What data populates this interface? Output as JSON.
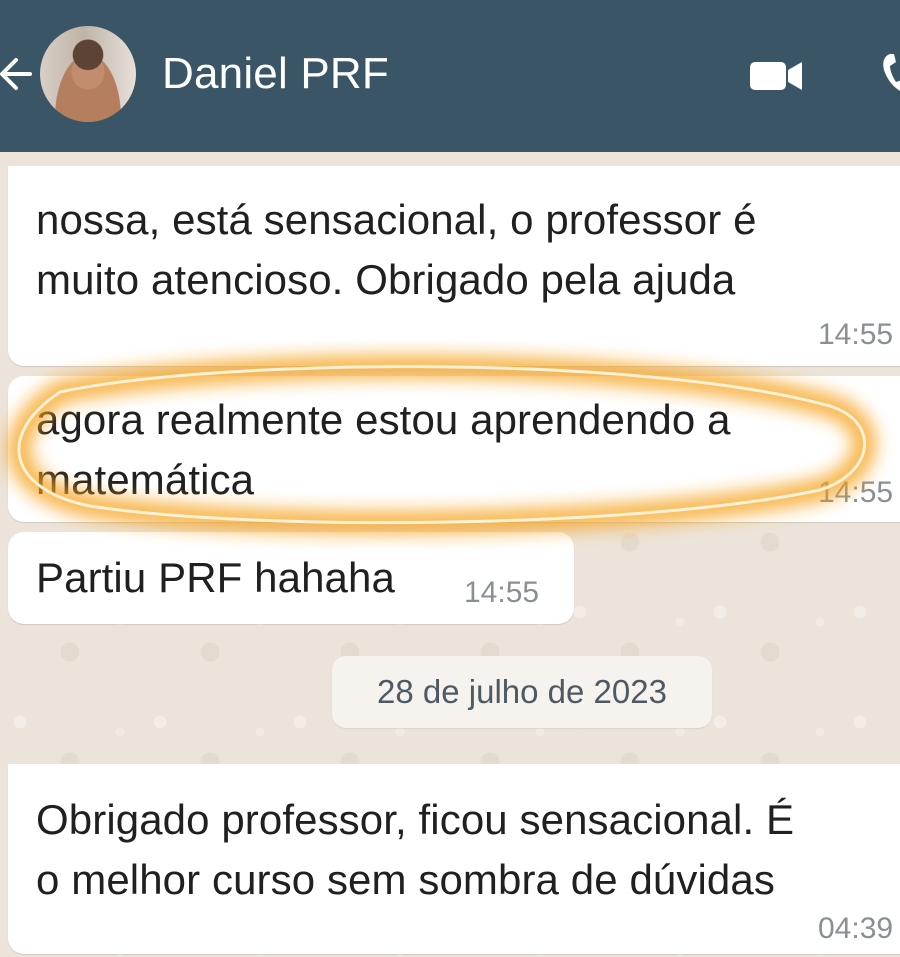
{
  "header": {
    "contact_name": "Daniel PRF",
    "back_icon": "arrow-left-icon",
    "video_icon": "videocam-icon",
    "call_icon": "phone-icon",
    "background": "#3a5565"
  },
  "messages": [
    {
      "text": "nossa, está sensacional, o professor é\nmuito atencioso. Obrigado pela ajuda",
      "time": "14:55"
    },
    {
      "text": "agora realmente estou aprendendo a\nmatemática",
      "time": "14:55",
      "highlighted": true
    },
    {
      "text": "Partiu PRF hahaha",
      "time": "14:55"
    },
    {
      "text": "Obrigado professor, ficou sensacional. É\no melhor curso sem sombra de dúvidas",
      "time": "04:39"
    }
  ],
  "date_separator": "28 de julho de 2023",
  "colors": {
    "highlight": "#f5a623",
    "wallpaper": "#ece4da",
    "bubble": "#ffffff"
  }
}
